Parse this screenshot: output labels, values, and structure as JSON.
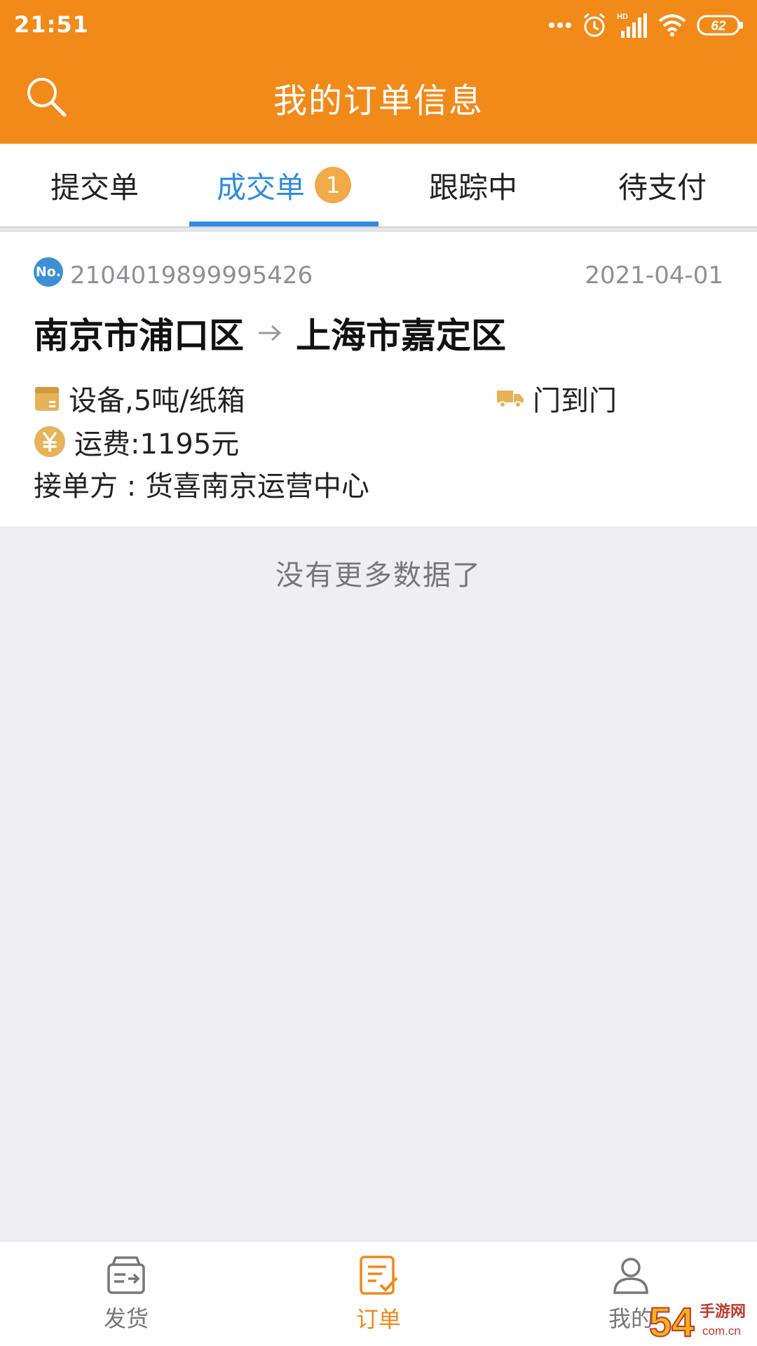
{
  "status_bar": {
    "time": "21:51",
    "network_label": "HD",
    "battery": "62",
    "icons": [
      "more-dots-icon",
      "alarm-icon",
      "signal-icon",
      "wifi-icon",
      "battery-icon"
    ]
  },
  "header": {
    "title": "我的订单信息",
    "search_icon": "search-icon",
    "background_color": "#f28a1a"
  },
  "tabs": [
    {
      "label": "提交单",
      "active": false
    },
    {
      "label": "成交单",
      "active": true,
      "badge": "1"
    },
    {
      "label": "跟踪中",
      "active": false
    },
    {
      "label": "待支付",
      "active": false
    }
  ],
  "order": {
    "number_badge": "No.",
    "number": "2104019899995426",
    "date": "2021-04-01",
    "origin": "南京市浦口区",
    "route_arrow": "→",
    "destination": "上海市嘉定区",
    "goods": "设备,5吨/纸箱",
    "delivery_mode": "门到门",
    "freight": "运费:1195元",
    "receiver": "接单方 : 货喜南京运营中心"
  },
  "list_end_text": "没有更多数据了",
  "bottom_nav": [
    {
      "label": "发货",
      "icon": "ship-box-icon",
      "active": false
    },
    {
      "label": "订单",
      "icon": "order-list-icon",
      "active": true
    },
    {
      "label": "我的",
      "icon": "user-icon",
      "active": false
    }
  ],
  "watermark": {
    "brand": "54",
    "site_text": "手游网",
    "domain_text": "com.cn"
  },
  "colors": {
    "accent_orange": "#f28a1a",
    "active_tab_blue": "#2f8be0",
    "badge_orange": "#f0aa48",
    "icon_gold": "#e6b25a",
    "page_background": "#efeef2"
  }
}
